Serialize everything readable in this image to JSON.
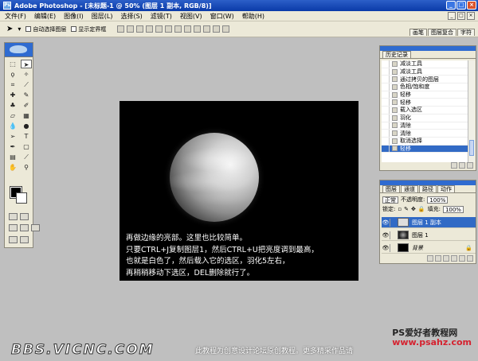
{
  "window": {
    "title": "Adobe Photoshop - [未标题-1 @ 50% (图层 1 副本, RGB/8)]"
  },
  "menu": [
    "文件(F)",
    "编辑(E)",
    "图像(I)",
    "图层(L)",
    "选择(S)",
    "滤镜(T)",
    "视图(V)",
    "窗口(W)",
    "帮助(H)"
  ],
  "options_bar": {
    "auto_select_label": "自动选择图层",
    "show_bounds_label": "显示定界框"
  },
  "palette_well": {
    "tabs": [
      "画笔",
      "图层复合",
      "字符"
    ]
  },
  "canvas": {
    "caption_lines": [
      "再做边缘的亮部。这里也比较简单。",
      "只要CTRL+J复制图层1，然后CTRL+U把亮度调到最高，",
      "也就是白色了，然后载入它的选区，羽化5左右，",
      "再稍稍移动下选区，DEL删除就行了。"
    ]
  },
  "history": {
    "tab": "历史记录",
    "items": [
      "减淡工具",
      "减淡工具",
      "通过拷贝的图层",
      "色相/饱和度",
      "轻移",
      "轻移",
      "载入选区",
      "羽化",
      "清除",
      "清除",
      "取消选择",
      "轻移"
    ]
  },
  "layers": {
    "tabs": [
      "图层",
      "通道",
      "路径",
      "动作"
    ],
    "blend_mode": "正常",
    "opacity_label": "不透明度:",
    "opacity_value": "100%",
    "lock_label": "锁定:",
    "fill_label": "填充:",
    "fill_value": "100%",
    "items": [
      "图层 1 副本",
      "图层 1",
      "背景"
    ]
  },
  "watermark": {
    "site_name": "PS爱好者教程网",
    "site_url": "www.psahz.com",
    "forum_logo": "BBS.VICNC.COM",
    "notice": "此教程为创意设计论坛原创教程。更多精采作品请"
  }
}
